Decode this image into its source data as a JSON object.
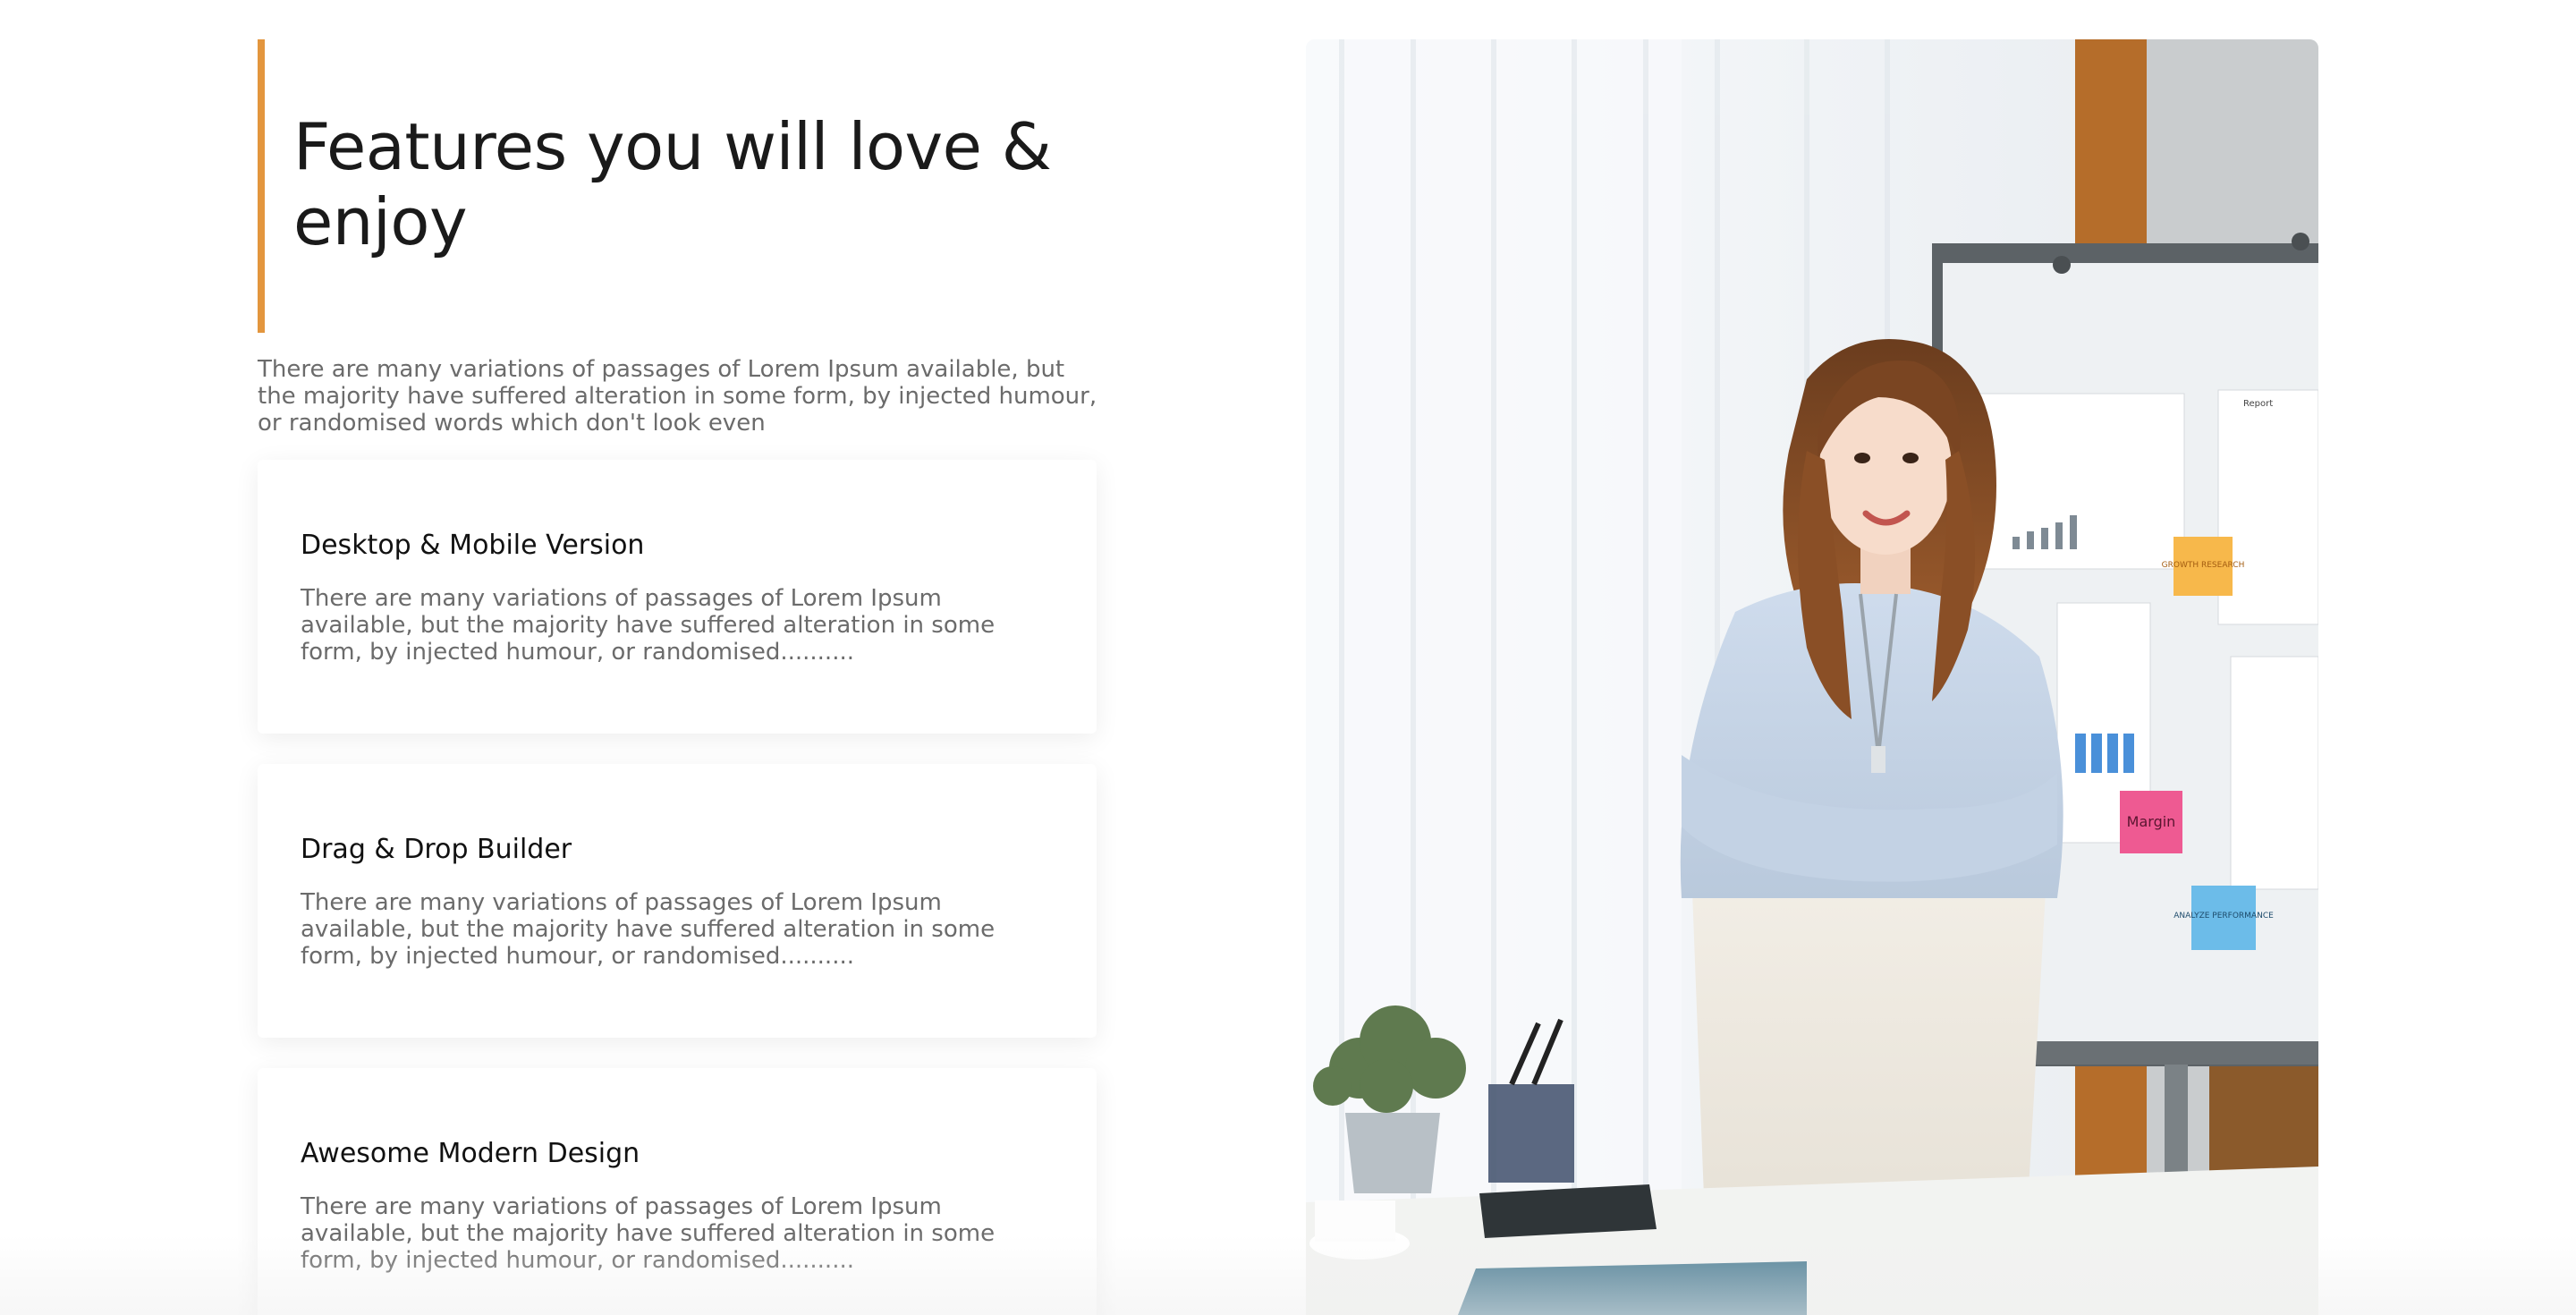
{
  "section": {
    "title": "Features you will love & enjoy",
    "intro": "There are many variations of passages of Lorem Ipsum available, but the majority have suffered alteration in some form, by injected humour, or randomised words which don't look even"
  },
  "features": [
    {
      "title": "Desktop & Mobile Version",
      "text": "There are many variations of passages of Lorem Ipsum available, but the majority have suffered alteration in some form, by injected humour, or randomised.........."
    },
    {
      "title": "Drag & Drop Builder",
      "text": "There are many variations of passages of Lorem Ipsum available, but the majority have suffered alteration in some form, by injected humour, or randomised.........."
    },
    {
      "title": "Awesome Modern Design",
      "text": "There are many variations of passages of Lorem Ipsum available, but the majority have suffered alteration in some form, by injected humour, or randomised.........."
    }
  ],
  "photo": {
    "sticky_notes": [
      "Margin",
      "ANALYZE PERFORMANCE",
      "GROWTH RESEARCH"
    ],
    "board_label": "Report"
  },
  "colors": {
    "accent": "#e3963e",
    "heading": "#1a1a1a",
    "body_text": "#6b6b6b"
  }
}
